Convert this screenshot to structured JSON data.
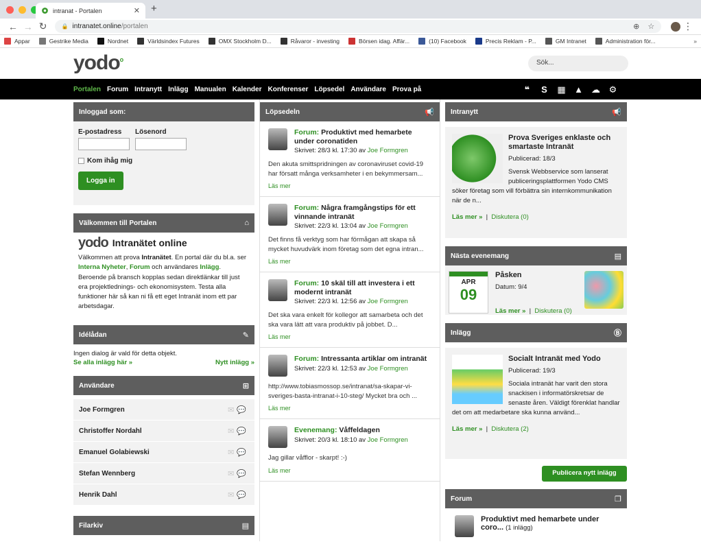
{
  "browser": {
    "tab_title": "intranat - Portalen",
    "url_host": "intranatet.online",
    "url_path": "/portalen",
    "bookmarks": [
      {
        "label": "Appar",
        "color": "#d44"
      },
      {
        "label": "Gestrike Media",
        "color": "#777"
      },
      {
        "label": "Nordnet",
        "color": "#111"
      },
      {
        "label": "Världsindex Futures",
        "color": "#333"
      },
      {
        "label": "OMX Stockholm D...",
        "color": "#333"
      },
      {
        "label": "Råvaror - investing",
        "color": "#333"
      },
      {
        "label": "Börsen idag. Affär...",
        "color": "#c33"
      },
      {
        "label": "(10) Facebook",
        "color": "#3b5998"
      },
      {
        "label": "Precis Reklam - P...",
        "color": "#1a3a8a"
      },
      {
        "label": "GM Intranet",
        "color": "#555"
      },
      {
        "label": "Administration för...",
        "color": "#555"
      }
    ],
    "more": "»"
  },
  "site": {
    "logo": "yodo",
    "search_placeholder": "Sök...",
    "nav": [
      "Portalen",
      "Forum",
      "Intranytt",
      "Inlägg",
      "Manualen",
      "Kalender",
      "Konferenser",
      "Löpsedel",
      "Användare",
      "Prova på"
    ]
  },
  "login": {
    "title": "Inloggad som:",
    "email_label": "E-postadress",
    "password_label": "Lösenord",
    "remember": "Kom ihåg mig",
    "button": "Logga in"
  },
  "welcome": {
    "title": "Välkommen till Portalen",
    "heading": "Intranätet online",
    "logo": "yodo",
    "p1": "Välkommen att prova ",
    "b1": "Intranätet",
    "p2": ". En portal där du bl.a. ser ",
    "l1": "Interna Nyheter",
    "p3": ", ",
    "l2": "Forum",
    "p4": " och användares ",
    "l3": "Inlägg",
    "p5": ". Beroende på bransch kopplas sedan direktlänkar till just era projektlednings- och ekonomisystem. Testa alla funktioner här så kan ni få ett eget Intranät inom ett par arbetsdagar."
  },
  "idea": {
    "title": "Idélådan",
    "text": "Ingen dialog är vald för detta objekt.",
    "all": "Se alla inlägg här »",
    "new": "Nytt inlägg »"
  },
  "users": {
    "title": "Användare",
    "list": [
      "Joe Formgren",
      "Christoffer Nordahl",
      "Emanuel Golabiewski",
      "Stefan Wennberg",
      "Henrik Dahl"
    ]
  },
  "files": {
    "title": "Filarkiv"
  },
  "lopsedel": {
    "title": "Löpsedeln",
    "read_more": "Läs mer",
    "posts": [
      {
        "cat": "Forum:",
        "title": " Produktivt med hemarbete under coronatiden",
        "meta": "Skrivet: 28/3 kl. 17:30 av ",
        "author": "Joe Formgren",
        "body": "Den akuta smittspridningen av coronaviruset covid-19 har försatt många verksamheter i en bekymmersam..."
      },
      {
        "cat": "Forum:",
        "title": " Några framgångstips för ett vinnande intranät",
        "meta": "Skrivet: 22/3 kl. 13:04 av ",
        "author": "Joe Formgren",
        "body": "Det finns få verktyg som har förmågan att skapa så mycket huvudvärk inom företag som det egna intran..."
      },
      {
        "cat": "Forum:",
        "title": " 10 skäl till att investera i ett modernt intranät",
        "meta": "Skrivet: 22/3 kl. 12:56 av ",
        "author": "Joe Formgren",
        "body": "Det ska vara enkelt för kollegor att samarbeta och det ska vara lätt att vara produktiv på jobbet. D..."
      },
      {
        "cat": "Forum:",
        "title": " Intressanta artiklar om intranät",
        "meta": "Skrivet: 22/3 kl. 12:53 av ",
        "author": "Joe Formgren",
        "body": "http://www.tobiasmossop.se/intranat/sa-skapar-vi-sveriges-basta-intranat-i-10-steg/ Mycket bra och ..."
      },
      {
        "cat": "Evenemang:",
        "title": " Våffeldagen",
        "meta": "Skrivet: 20/3 kl. 18:10 av ",
        "author": "Joe Formgren",
        "body": "Jag gillar våfflor - skarpt! :-)"
      }
    ]
  },
  "intranytt": {
    "title": "Intranytt",
    "item_title": "Prova Sveriges enklaste och smartaste Intranät",
    "published": "Publicerad: 18/3",
    "body": "Svensk Webbservice som lanserat publiceringsplattformen Yodo CMS söker företag som vill förbättra sin internkommunikation när de n...",
    "read_more": "Läs mer »",
    "sep": "|",
    "discuss": "Diskutera (0)"
  },
  "event": {
    "title": "Nästa evenemang",
    "month": "APR",
    "day": "09",
    "name": "Påsken",
    "date": "Datum: 9/4",
    "read_more": "Läs mer »",
    "sep": "|",
    "discuss": "Diskutera (0)"
  },
  "inlagg": {
    "title": "Inlägg",
    "item_title": "Socialt Intranät med Yodo",
    "published": "Publicerad: 19/3",
    "body": "Sociala intranät har varit den stora snackisen i informatörskretsar de senaste åren. Väldigt förenklat handlar det om att medarbetare ska kunna använd...",
    "read_more": "Läs mer »",
    "sep": "|",
    "discuss": "Diskutera (2)",
    "publish_button": "Publicera nytt inlägg"
  },
  "forum": {
    "title": "Forum",
    "item": "Produktivt med hemarbete under coro...",
    "count": "(1 inlägg)"
  }
}
